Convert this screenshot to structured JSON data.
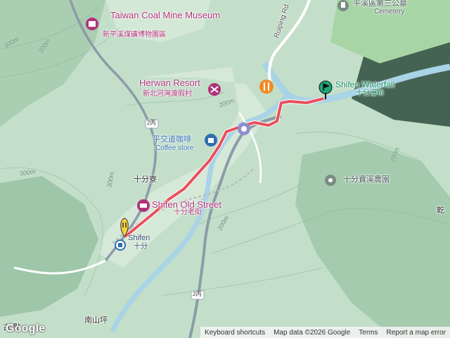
{
  "map": {
    "places": {
      "cemetery": {
        "zh": "平溪區第三公墓",
        "en": "Cemetery"
      },
      "coal_museum": {
        "en": "Taiwan Coal Mine Museum",
        "zh": "新平溪煤礦博物園區"
      },
      "herwan": {
        "en": "Herwan Resort",
        "zh": "新北河灣渡假村"
      },
      "coffee": {
        "zh": "平交道咖啡",
        "en": "Coffee store"
      },
      "shifen_waterfall": {
        "en": "Shifen Waterfall",
        "zh": "十分瀑布"
      },
      "farm": {
        "zh": "十分寶溪農園"
      },
      "shiliao": {
        "zh": "十分寮"
      },
      "old_street": {
        "en": "Shifen Old Street",
        "zh": "十分老街"
      },
      "shifen_station": {
        "en": "Shifen",
        "zh": "十分"
      },
      "nanshanping": {
        "zh": "南山坪"
      },
      "edge_label": {
        "zh": "乾"
      },
      "bottom_left": {
        "zh": "古·點"
      }
    },
    "roads": {
      "ruiping": "Ruiping Rd",
      "route_2bing_a": "2丙",
      "route_2bing_b": "2丙"
    },
    "contours": [
      "300m",
      "300m",
      "200m",
      "200m",
      "300m",
      "200m",
      "200m"
    ],
    "route_color": "#e8505b",
    "water_color": "#a9d3e6"
  },
  "attribution": {
    "keyboard": "Keyboard shortcuts",
    "data": "Map data ©2026 Google",
    "terms": "Terms",
    "report": "Report a map error"
  },
  "logo": "Google"
}
